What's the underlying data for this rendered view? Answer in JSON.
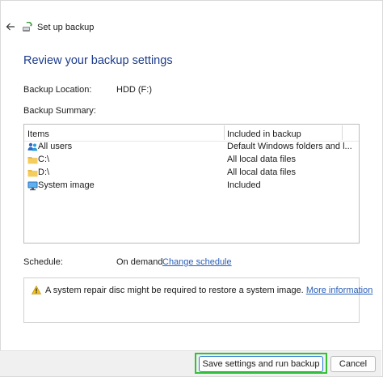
{
  "window": {
    "title": "Set up backup"
  },
  "heading": "Review your backup settings",
  "backup_location": {
    "label": "Backup Location:",
    "value": "HDD (F:)"
  },
  "backup_summary": {
    "label": "Backup Summary:"
  },
  "table": {
    "columns": [
      "Items",
      "Included in backup"
    ],
    "rows": [
      {
        "icon": "users-icon",
        "item": "All users",
        "included": "Default Windows folders and l..."
      },
      {
        "icon": "folder-icon",
        "item": "C:\\",
        "included": "All local data files"
      },
      {
        "icon": "folder-icon",
        "item": "D:\\",
        "included": "All local data files"
      },
      {
        "icon": "monitor-icon",
        "item": "System image",
        "included": "Included"
      }
    ]
  },
  "schedule": {
    "label": "Schedule:",
    "value": "On demand",
    "link": "Change schedule"
  },
  "notice": {
    "icon": "warning-icon",
    "text": "A system repair disc might be required to restore a system image.",
    "link": "More information"
  },
  "buttons": {
    "primary": "Save settings and run backup",
    "cancel": "Cancel"
  },
  "colors": {
    "heading": "#1c3c8c",
    "link": "#2a5fb8",
    "highlight": "#34c234",
    "folder": "#e8b84a",
    "warning": "#f2c01e"
  }
}
